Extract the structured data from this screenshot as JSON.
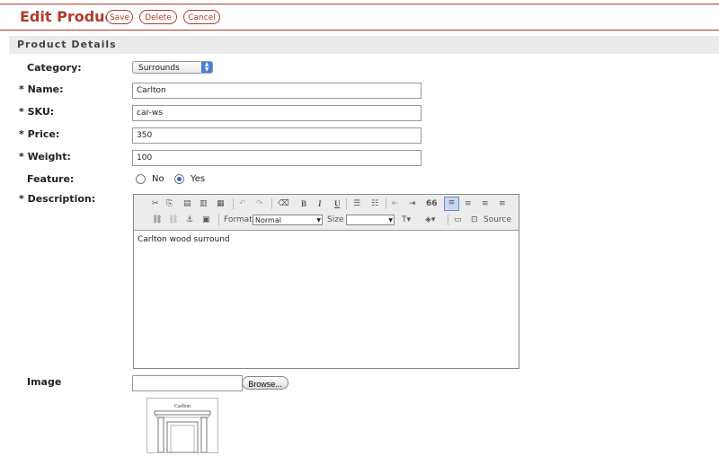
{
  "header": {
    "title": "Edit Product",
    "save_label": "Save",
    "delete_label": "Delete",
    "cancel_label": "Cancel"
  },
  "section_title": "Product Details",
  "form": {
    "category_label": "Category:",
    "category_value": "Surrounds",
    "name_label": "* Name:",
    "name_value": "Carlton",
    "sku_label": "* SKU:",
    "sku_value": "car-ws",
    "price_label": "* Price:",
    "price_value": "350",
    "weight_label": "* Weight:",
    "weight_value": "100",
    "feature_label": "Feature:",
    "feature_no": "No",
    "feature_yes": "Yes",
    "feature_selected": "Yes",
    "description_label": "* Description:",
    "image_label": "Image",
    "browse_label": "Browse..."
  },
  "editor": {
    "format_label": "Format",
    "format_value": "Normal",
    "size_label": "Size",
    "size_value": "",
    "source_label": "Source",
    "content": "Carlton wood surround",
    "bold_glyph": "B",
    "italic_glyph": "I",
    "underline_glyph": "U",
    "quote_glyph": "66"
  },
  "thumbnail_caption": "Carlton"
}
